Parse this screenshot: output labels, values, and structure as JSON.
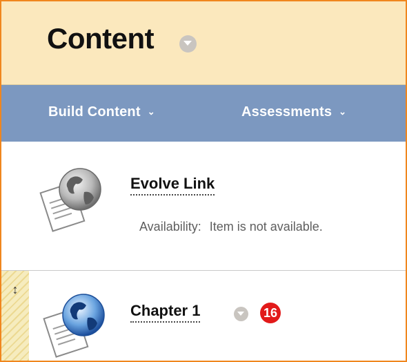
{
  "page": {
    "title": "Content"
  },
  "toolbar": {
    "build_content_label": "Build Content",
    "assessments_label": "Assessments",
    "chevron": "⌄"
  },
  "items": [
    {
      "title": "Evolve Link",
      "icon": "web-link-icon",
      "availability_label": "Availability:",
      "availability_value": "Item is not available."
    },
    {
      "title": "Chapter 1",
      "icon": "web-link-icon",
      "badge": "16"
    }
  ],
  "colors": {
    "header_bg": "#fbe8bd",
    "toolbar_bg": "#7c98c0",
    "border_accent": "#f0861e",
    "badge": "#e21a1a"
  }
}
